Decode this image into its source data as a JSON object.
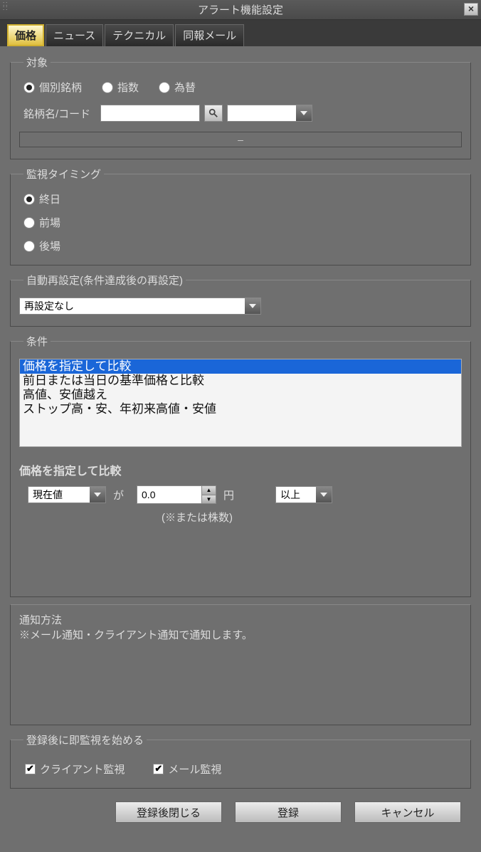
{
  "window": {
    "title": "アラート機能設定",
    "close_glyph": "×"
  },
  "tabs": [
    {
      "label": "価格",
      "active": true
    },
    {
      "label": "ニュース",
      "active": false
    },
    {
      "label": "テクニカル",
      "active": false
    },
    {
      "label": "同報メール",
      "active": false
    }
  ],
  "target": {
    "legend": "対象",
    "options": [
      {
        "label": "個別銘柄",
        "checked": true
      },
      {
        "label": "指数",
        "checked": false
      },
      {
        "label": "為替",
        "checked": false
      }
    ],
    "code_label": "銘柄名/コード",
    "code_value": "",
    "dropdown_value": "",
    "dash": "–"
  },
  "timing": {
    "legend": "監視タイミング",
    "options": [
      {
        "label": "終日",
        "checked": true
      },
      {
        "label": "前場",
        "checked": false
      },
      {
        "label": "後場",
        "checked": false
      }
    ]
  },
  "auto_reset": {
    "legend": "自動再設定(条件達成後の再設定)",
    "selected": "再設定なし"
  },
  "condition": {
    "legend": "条件",
    "list": [
      "価格を指定して比較",
      "前日または当日の基準価格と比較",
      "高値、安値越え",
      "ストップ高・安、年初来高値・安値"
    ],
    "selected_index": 0,
    "sub_header": "価格を指定して比較",
    "price_type": "現在値",
    "ga": "が",
    "price_value": "0.0",
    "yen": "円",
    "comparator": "以上",
    "note": "(※または株数)"
  },
  "notify": {
    "head": "通知方法",
    "body": "※メール通知・クライアント通知で通知します。"
  },
  "start": {
    "legend": "登録後に即監視を始める",
    "opts": [
      {
        "label": "クライアント監視",
        "checked": true
      },
      {
        "label": "メール監視",
        "checked": true
      }
    ]
  },
  "footer": {
    "close_after": "登録後閉じる",
    "register": "登録",
    "cancel": "キャンセル"
  }
}
